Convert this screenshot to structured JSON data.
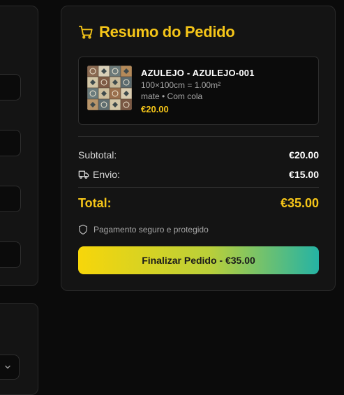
{
  "colors": {
    "accent": "#f5c518",
    "cta_start": "#f7d60a",
    "cta_end": "#25b3a4"
  },
  "summary": {
    "title": "Resumo do Pedido",
    "title_icon": "cart-icon"
  },
  "item": {
    "name": "AZULEJO - AZULEJO-001",
    "dimensions": "100×100cm = 1.00m²",
    "finish": "mate • Com cola",
    "price": "€20.00"
  },
  "totals": {
    "subtotal_label": "Subtotal:",
    "subtotal_value": "€20.00",
    "shipping_label": "Envio:",
    "shipping_icon": "truck-icon",
    "shipping_value": "€15.00",
    "total_label": "Total:",
    "total_value": "€35.00"
  },
  "secure_text": "Pagamento seguro e protegido",
  "secure_icon": "shield-icon",
  "checkout_button": "Finalizar Pedido - €35.00"
}
